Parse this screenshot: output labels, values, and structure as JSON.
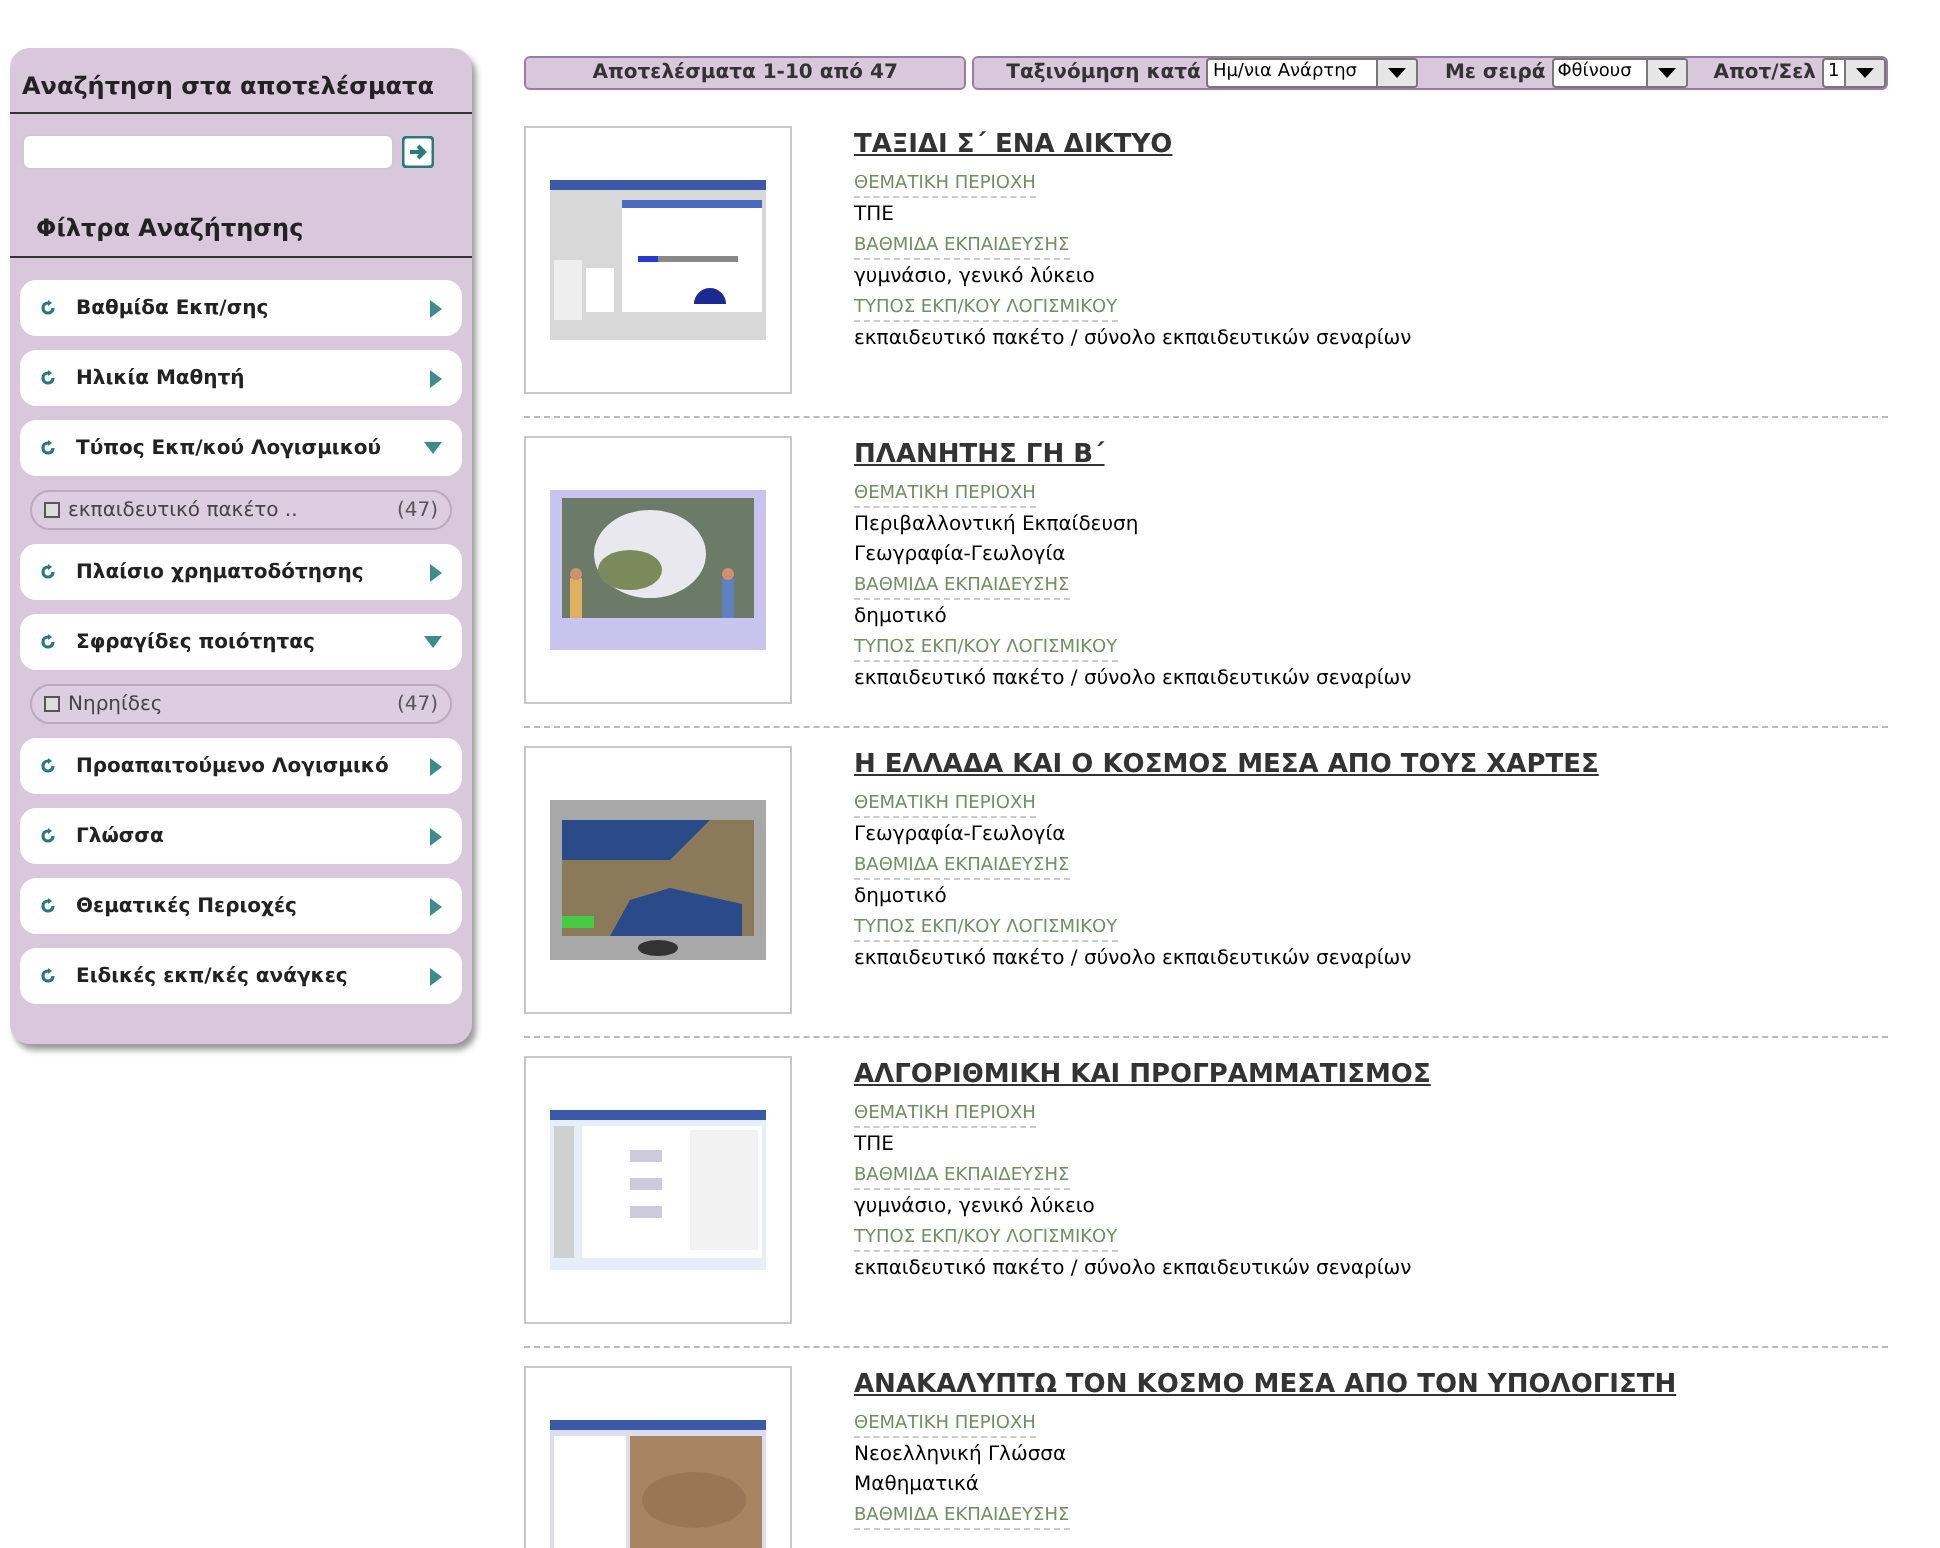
{
  "sidebar": {
    "search_title": "Αναζήτηση στα αποτελέσματα",
    "filters_title": "Φίλτρα Αναζήτησης",
    "filters": [
      {
        "label": "Βαθμίδα Εκπ/σης",
        "expanded": false
      },
      {
        "label": "Ηλικία Μαθητή",
        "expanded": false
      },
      {
        "label": "Τύπος Εκπ/κού Λογισμικού",
        "expanded": true,
        "options": [
          {
            "label": "εκπαιδευτικό πακέτο ..",
            "count": "(47)",
            "checked": false
          }
        ]
      },
      {
        "label": "Πλαίσιο χρηματοδότησης",
        "expanded": false
      },
      {
        "label": "Σφραγίδες ποιότητας",
        "expanded": true,
        "options": [
          {
            "label": "Νηρηίδες",
            "count": "(47)",
            "checked": false
          }
        ]
      },
      {
        "label": "Προαπαιτούμενο Λογισμικό",
        "expanded": false
      },
      {
        "label": "Γλώσσα",
        "expanded": false
      },
      {
        "label": "Θεματικές Περιοχές",
        "expanded": false
      },
      {
        "label": "Ειδικές εκπ/κές ανάγκες",
        "expanded": false
      }
    ]
  },
  "toolbar": {
    "results": "Αποτελέσματα 1-10 από 47",
    "sort_label": "Ταξινόμηση κατά",
    "sort_value": "Ημ/νια Ανάρτησ",
    "order_label": "Με σειρά",
    "order_value": "Φθίνουσ",
    "per_page_label": "Αποτ/Σελ",
    "per_page_value": "1"
  },
  "results": [
    {
      "title": "ΤΑΞΙΔΙ Σ΄ ΕΝΑ ΔΙΚΤΥΟ",
      "fields": [
        {
          "label": "ΘΕΜΑΤΙΚΗ ΠΕΡΙΟΧΗ",
          "values": [
            "ΤΠΕ"
          ]
        },
        {
          "label": "ΒΑΘΜΙΔΑ ΕΚΠΑΙΔΕΥΣΗΣ",
          "values": [
            "γυμνάσιο, γενικό λύκειο"
          ]
        },
        {
          "label": "ΤΥΠΟΣ ΕΚΠ/ΚΟΥ ΛΟΓΙΣΜΙΚΟΥ",
          "values": [
            "εκπαιδευτικό πακέτο / σύνολο εκπαιδευτικών σεναρίων"
          ]
        }
      ]
    },
    {
      "title": "ΠΛΑΝΗΤΗΣ ΓΗ Β΄",
      "fields": [
        {
          "label": "ΘΕΜΑΤΙΚΗ ΠΕΡΙΟΧΗ",
          "values": [
            "Περιβαλλοντική Εκπαίδευση",
            "Γεωγραφία-Γεωλογία"
          ]
        },
        {
          "label": "ΒΑΘΜΙΔΑ ΕΚΠΑΙΔΕΥΣΗΣ",
          "values": [
            "δημοτικό"
          ]
        },
        {
          "label": "ΤΥΠΟΣ ΕΚΠ/ΚΟΥ ΛΟΓΙΣΜΙΚΟΥ",
          "values": [
            "εκπαιδευτικό πακέτο / σύνολο εκπαιδευτικών σεναρίων"
          ]
        }
      ]
    },
    {
      "title": "Η ΕΛΛΑΔΑ ΚΑΙ Ο ΚΟΣΜΟΣ ΜΕΣΑ ΑΠΟ ΤΟΥΣ ΧΑΡΤΕΣ",
      "fields": [
        {
          "label": "ΘΕΜΑΤΙΚΗ ΠΕΡΙΟΧΗ",
          "values": [
            "Γεωγραφία-Γεωλογία"
          ]
        },
        {
          "label": "ΒΑΘΜΙΔΑ ΕΚΠΑΙΔΕΥΣΗΣ",
          "values": [
            "δημοτικό"
          ]
        },
        {
          "label": "ΤΥΠΟΣ ΕΚΠ/ΚΟΥ ΛΟΓΙΣΜΙΚΟΥ",
          "values": [
            "εκπαιδευτικό πακέτο / σύνολο εκπαιδευτικών σεναρίων"
          ]
        }
      ]
    },
    {
      "title": "ΑΛΓΟΡΙΘΜΙΚΗ ΚΑΙ ΠΡΟΓΡΑΜΜΑΤΙΣΜΟΣ",
      "fields": [
        {
          "label": "ΘΕΜΑΤΙΚΗ ΠΕΡΙΟΧΗ",
          "values": [
            "ΤΠΕ"
          ]
        },
        {
          "label": "ΒΑΘΜΙΔΑ ΕΚΠΑΙΔΕΥΣΗΣ",
          "values": [
            "γυμνάσιο, γενικό λύκειο"
          ]
        },
        {
          "label": "ΤΥΠΟΣ ΕΚΠ/ΚΟΥ ΛΟΓΙΣΜΙΚΟΥ",
          "values": [
            "εκπαιδευτικό πακέτο / σύνολο εκπαιδευτικών σεναρίων"
          ]
        }
      ]
    },
    {
      "title": "ΑΝΑΚΑΛΥΠΤΩ ΤΟΝ ΚΟΣΜΟ ΜΕΣΑ ΑΠΟ ΤΟΝ ΥΠΟΛΟΓΙΣΤΗ",
      "fields": [
        {
          "label": "ΘΕΜΑΤΙΚΗ ΠΕΡΙΟΧΗ",
          "values": [
            "Νεοελληνική Γλώσσα",
            "Μαθηματικά"
          ]
        },
        {
          "label": "ΒΑΘΜΙΔΑ ΕΚΠΑΙΔΕΥΣΗΣ"
        }
      ]
    }
  ]
}
